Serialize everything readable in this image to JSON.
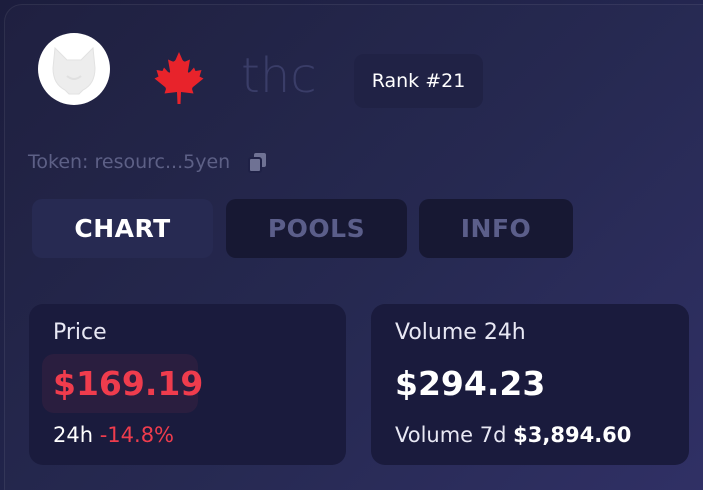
{
  "header": {
    "ticker": "thc",
    "rank": "Rank #21"
  },
  "token": {
    "label": "Token: resourc...5yen"
  },
  "tabs": [
    {
      "label": "CHART",
      "active": true
    },
    {
      "label": "POOLS",
      "active": false
    },
    {
      "label": "INFO",
      "active": false
    }
  ],
  "price_card": {
    "label": "Price",
    "value": "$169.19",
    "change_period": "24h",
    "change_value": "-14.8%"
  },
  "volume_card": {
    "label": "Volume 24h",
    "value": "$294.23",
    "volume7d_label": "Volume 7d",
    "volume7d_value": "$3,894.60"
  },
  "icons": {
    "avatar": "dog-head-icon",
    "flag": "maple-leaf-icon",
    "copy": "copy-icon"
  },
  "colors": {
    "negative": "#ef3c4d",
    "leaf": "#e8232b",
    "background": "#1c1d3d"
  }
}
